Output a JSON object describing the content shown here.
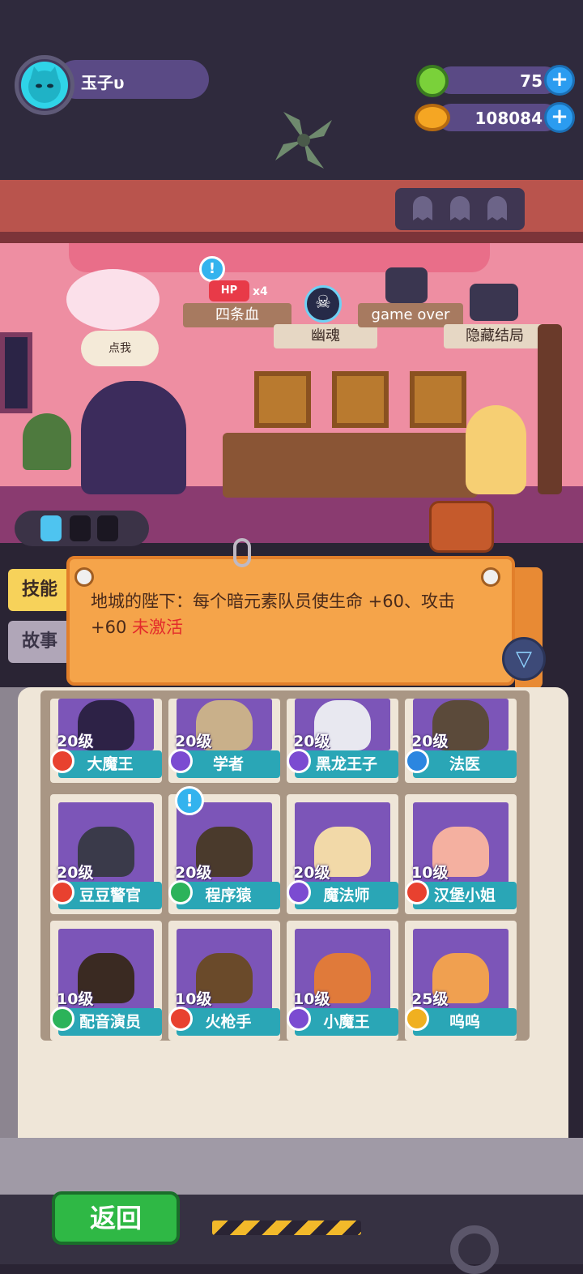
{
  "player": {
    "name": "玉子υ"
  },
  "resources": {
    "gems": "75",
    "coins": "108084"
  },
  "room": {
    "signs": [
      "四条血",
      "幽魂",
      "game over",
      "隐藏结局"
    ],
    "hp_badge": "HP",
    "hp_multiplier": "x4",
    "speech_bubble": "点我"
  },
  "side_tabs": {
    "skills": "技能",
    "story": "故事"
  },
  "notice": {
    "text": "地城的陛下：每个暗元素队员使生命 +60、攻击 +60",
    "status": "未激活"
  },
  "characters": [
    {
      "level": "20级",
      "name": "大魔王",
      "badge_color": "#e8412f"
    },
    {
      "level": "20级",
      "name": "学者",
      "badge_color": "#7b4bd1"
    },
    {
      "level": "20级",
      "name": "黑龙王子",
      "badge_color": "#7b4bd1"
    },
    {
      "level": "20级",
      "name": "法医",
      "badge_color": "#2b86e0"
    },
    {
      "level": "20级",
      "name": "豆豆警官",
      "badge_color": "#e8412f"
    },
    {
      "level": "20级",
      "name": "程序猿",
      "badge_color": "#2cb35a"
    },
    {
      "level": "20级",
      "name": "魔法师",
      "badge_color": "#7b4bd1"
    },
    {
      "level": "10级",
      "name": "汉堡小姐",
      "badge_color": "#e8412f"
    },
    {
      "level": "10级",
      "name": "配音演员",
      "badge_color": "#2cb35a"
    },
    {
      "level": "10级",
      "name": "火枪手",
      "badge_color": "#e8412f"
    },
    {
      "level": "10级",
      "name": "小魔王",
      "badge_color": "#7b4bd1"
    },
    {
      "level": "25级",
      "name": "呜呜",
      "badge_color": "#f0b020"
    }
  ],
  "buttons": {
    "back": "返回"
  },
  "colors": {
    "accent": "#f5a44a",
    "name_bar": "#2aa6b6",
    "back_button": "#2fb845"
  }
}
